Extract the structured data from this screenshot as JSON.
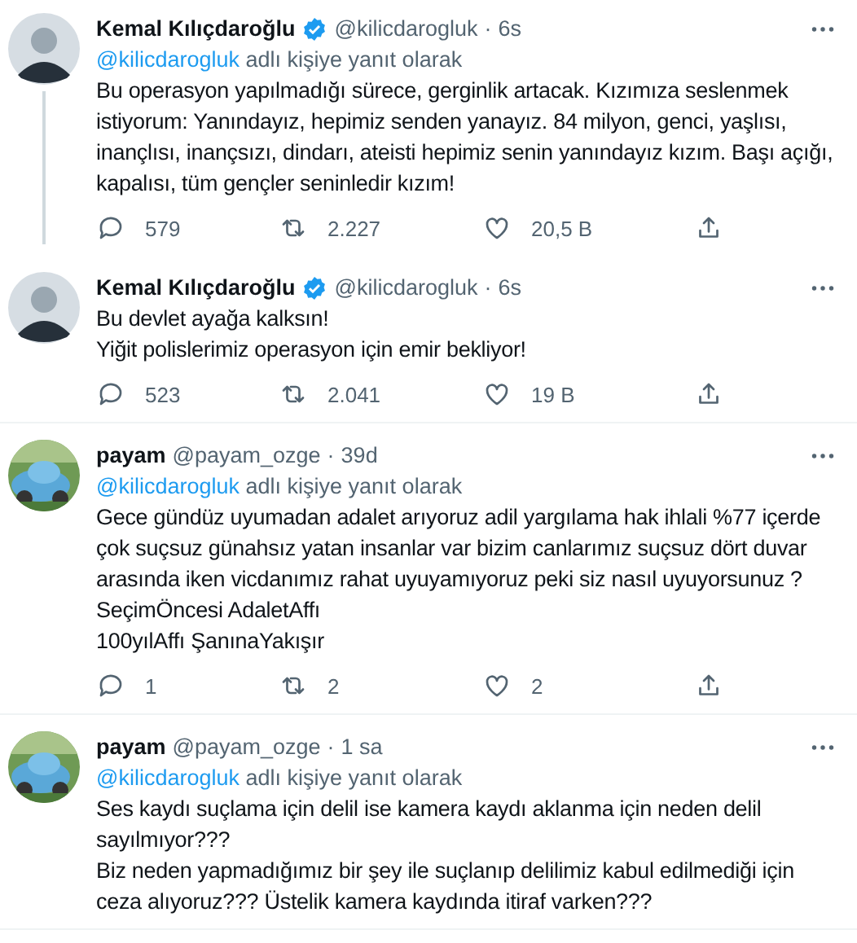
{
  "tweets": [
    {
      "avatar": {
        "kind": "silhouette"
      },
      "name": "Kemal Kılıçdaroğlu",
      "verified": true,
      "handle": "@kilicdarogluk",
      "dot": "·",
      "time": "6s",
      "thread_line": true,
      "reply_to": {
        "mention": "@kilicdarogluk",
        "text": "adlı kişiye yanıt olarak"
      },
      "body": [
        "Bu operasyon yapılmadığı sürece, gerginlik artacak. Kızımıza seslenmek istiyorum: Yanındayız, hepimiz senden yanayız. 84 milyon, genci, yaşlısı, inançlısı, inançsızı, dindarı, ateisti hepimiz senin yanındayız kızım. Başı açığı, kapalısı, tüm gençler seninledir kızım!"
      ],
      "replies": "579",
      "retweets": "2.227",
      "likes": "20,5 B"
    },
    {
      "avatar": {
        "kind": "silhouette"
      },
      "name": "Kemal Kılıçdaroğlu",
      "verified": true,
      "handle": "@kilicdarogluk",
      "dot": "·",
      "time": "6s",
      "thread_line": false,
      "body": [
        "Bu devlet ayağa kalksın!",
        "Yiğit polislerimiz operasyon için emir bekliyor!"
      ],
      "replies": "523",
      "retweets": "2.041",
      "likes": "19 B"
    },
    {
      "avatar": {
        "kind": "picture"
      },
      "name": "payam",
      "verified": false,
      "handle": "@payam_ozge",
      "dot": "·",
      "time": "39d",
      "thread_line": false,
      "reply_to": {
        "mention": "@kilicdarogluk",
        "text": "adlı kişiye yanıt olarak"
      },
      "body": [
        "Gece gündüz uyumadan adalet arıyoruz adil yargılama hak ihlali %77 içerde çok suçsuz günahsız yatan insanlar var bizim canlarımız suçsuz dört duvar arasında iken vicdanımız rahat uyuyamıyoruz peki siz nasıl uyuyorsunuz ?",
        "SeçimÖncesi AdaletAffı",
        "100yılAffı ŞanınaYakışır"
      ],
      "replies": "1",
      "retweets": "2",
      "likes": "2"
    },
    {
      "avatar": {
        "kind": "picture"
      },
      "name": "payam",
      "verified": false,
      "handle": "@payam_ozge",
      "dot": "·",
      "time": "1 sa",
      "thread_line": false,
      "reply_to": {
        "mention": "@kilicdarogluk",
        "text": "adlı kişiye yanıt olarak"
      },
      "body": [
        "Ses kaydı suçlama için delil ise kamera kaydı aklanma için neden delil sayılmıyor???",
        "Biz neden yapmadığımız bir şey ile suçlanıp delilimiz kabul edilmediği için ceza alıyoruz??? Üstelik kamera kaydında itiraf varken???"
      ]
    }
  ]
}
